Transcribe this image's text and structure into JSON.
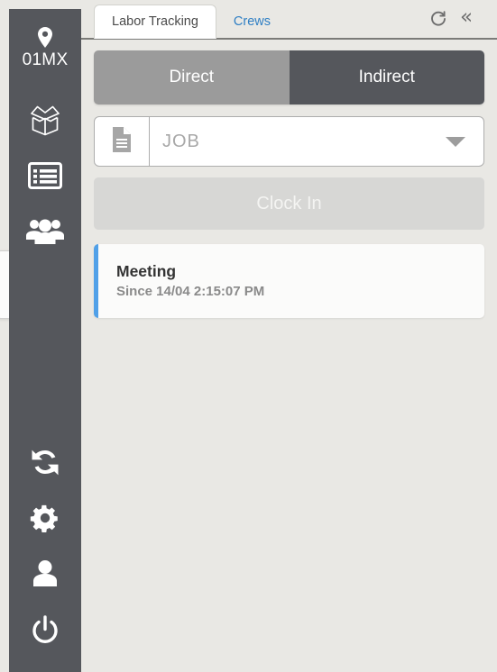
{
  "sidebar": {
    "location": {
      "icon": "location-pin-icon",
      "label": "01MX"
    },
    "items": [
      {
        "icon": "open-box-icon",
        "name": "inventory"
      },
      {
        "icon": "list-view-icon",
        "name": "list"
      },
      {
        "icon": "people-group-icon",
        "name": "crews"
      }
    ],
    "bottom_items": [
      {
        "icon": "sync-icon",
        "name": "sync"
      },
      {
        "icon": "gear-icon",
        "name": "settings"
      },
      {
        "icon": "user-icon",
        "name": "profile"
      },
      {
        "icon": "power-icon",
        "name": "logout"
      }
    ]
  },
  "tabs": [
    {
      "label": "Labor Tracking",
      "active": true
    },
    {
      "label": "Crews",
      "active": false
    }
  ],
  "toolbar": {
    "refresh_icon": "refresh-icon",
    "collapse_icon": "double-chevron-left-icon",
    "collapse_glyph": "«"
  },
  "segmented": {
    "options": [
      {
        "label": "Direct",
        "selected": false
      },
      {
        "label": "Indirect",
        "selected": true
      }
    ]
  },
  "job_select": {
    "icon": "document-icon",
    "placeholder": "JOB",
    "value": "",
    "caret_icon": "caret-down-icon"
  },
  "clock_in": {
    "label": "Clock In",
    "disabled": true
  },
  "activity": {
    "title": "Meeting",
    "subtitle": "Since 14/04 2:15:07 PM",
    "accent_color": "#50a0e8"
  },
  "colors": {
    "sidebar": "#55575c",
    "content_bg": "#e9e8e4",
    "segment_on": "#55575c",
    "segment_off": "#9b9b9b",
    "tab_link": "#2f7fc4",
    "accent": "#50a0e8"
  }
}
